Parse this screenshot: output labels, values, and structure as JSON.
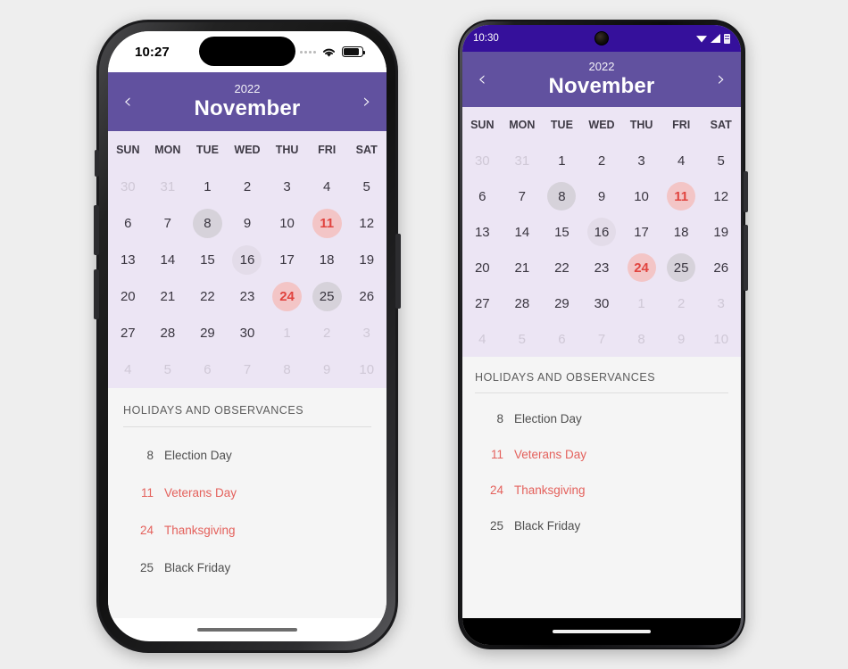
{
  "theme": {
    "header_purple": "#61519f",
    "android_statusbar_purple": "#35109b",
    "calendar_bg": "#ece5f4",
    "holiday_bg": "#f5f5f5",
    "accent_red": "#e1443f",
    "pink_circle": "#f3c5c6",
    "gray_circle": "#d6d2da"
  },
  "iphone": {
    "status": {
      "time": "10:27",
      "cellular_icon": "cellular-dots-icon",
      "wifi_icon": "wifi-icon",
      "battery_icon": "battery-icon"
    },
    "home_indicator": "home-indicator"
  },
  "android": {
    "status": {
      "time": "10:30",
      "camera_icon": "front-camera-punch-hole-icon",
      "wifi_icon": "wifi-icon",
      "signal_icon": "signal-icon",
      "battery_icon": "battery-icon"
    },
    "home_indicator": "home-indicator"
  },
  "calendar": {
    "prev_label": "‹",
    "next_label": "›",
    "year": "2022",
    "month": "November",
    "weekdays": [
      "SUN",
      "MON",
      "TUE",
      "WED",
      "THU",
      "FRI",
      "SAT"
    ],
    "days": [
      {
        "n": "30",
        "style": "muted"
      },
      {
        "n": "31",
        "style": "muted"
      },
      {
        "n": "1",
        "style": "normal"
      },
      {
        "n": "2",
        "style": "normal"
      },
      {
        "n": "3",
        "style": "normal"
      },
      {
        "n": "4",
        "style": "normal"
      },
      {
        "n": "5",
        "style": "normal"
      },
      {
        "n": "6",
        "style": "normal"
      },
      {
        "n": "7",
        "style": "normal"
      },
      {
        "n": "8",
        "style": "gray"
      },
      {
        "n": "9",
        "style": "normal"
      },
      {
        "n": "10",
        "style": "normal"
      },
      {
        "n": "11",
        "style": "pink"
      },
      {
        "n": "12",
        "style": "normal"
      },
      {
        "n": "13",
        "style": "normal"
      },
      {
        "n": "14",
        "style": "normal"
      },
      {
        "n": "15",
        "style": "normal"
      },
      {
        "n": "16",
        "style": "graylight"
      },
      {
        "n": "17",
        "style": "normal"
      },
      {
        "n": "18",
        "style": "normal"
      },
      {
        "n": "19",
        "style": "normal"
      },
      {
        "n": "20",
        "style": "normal"
      },
      {
        "n": "21",
        "style": "normal"
      },
      {
        "n": "22",
        "style": "normal"
      },
      {
        "n": "23",
        "style": "normal"
      },
      {
        "n": "24",
        "style": "pink"
      },
      {
        "n": "25",
        "style": "gray"
      },
      {
        "n": "26",
        "style": "normal"
      },
      {
        "n": "27",
        "style": "normal"
      },
      {
        "n": "28",
        "style": "normal"
      },
      {
        "n": "29",
        "style": "normal"
      },
      {
        "n": "30",
        "style": "normal"
      },
      {
        "n": "1",
        "style": "muted"
      },
      {
        "n": "2",
        "style": "muted"
      },
      {
        "n": "3",
        "style": "muted"
      },
      {
        "n": "4",
        "style": "muted"
      },
      {
        "n": "5",
        "style": "muted"
      },
      {
        "n": "6",
        "style": "muted"
      },
      {
        "n": "7",
        "style": "muted"
      },
      {
        "n": "8",
        "style": "muted"
      },
      {
        "n": "9",
        "style": "muted"
      },
      {
        "n": "10",
        "style": "muted"
      }
    ]
  },
  "holidays": {
    "title": "HOLIDAYS AND OBSERVANCES",
    "items": [
      {
        "day": "8",
        "name": "Election Day",
        "highlight": false
      },
      {
        "day": "11",
        "name": "Veterans Day",
        "highlight": true
      },
      {
        "day": "24",
        "name": "Thanksgiving",
        "highlight": true
      },
      {
        "day": "25",
        "name": "Black Friday",
        "highlight": false
      }
    ]
  }
}
